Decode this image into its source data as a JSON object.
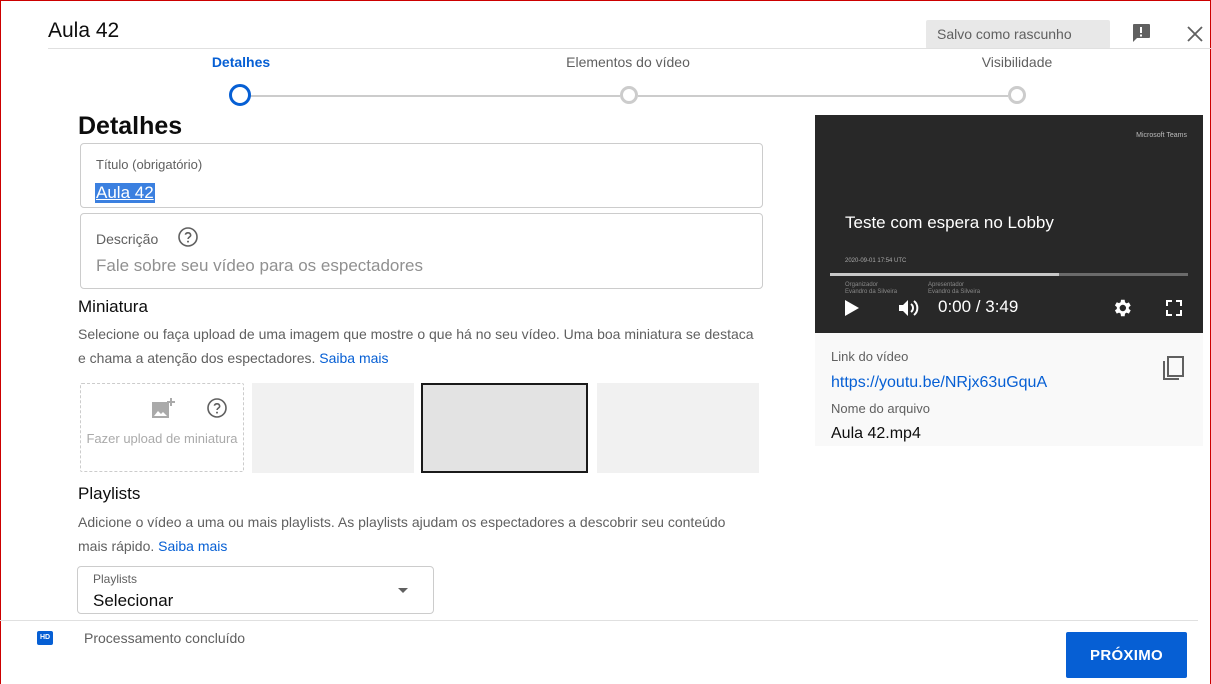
{
  "header": {
    "title": "Aula 42",
    "draft_status": "Salvo como rascunho"
  },
  "stepper": {
    "steps": [
      {
        "label": "Detalhes",
        "state": "active"
      },
      {
        "label": "Elementos do vídeo",
        "state": "inactive"
      },
      {
        "label": "Visibilidade",
        "state": "inactive"
      }
    ]
  },
  "details": {
    "heading": "Detalhes",
    "title_field": {
      "label": "Título (obrigatório)",
      "value": "Aula 42"
    },
    "description_field": {
      "label": "Descrição",
      "placeholder": "Fale sobre seu vídeo para os espectadores"
    }
  },
  "thumbnail": {
    "heading": "Miniatura",
    "description": "Selecione ou faça upload de uma imagem que mostre o que há no seu vídeo. Uma boa miniatura se destaca e chama a atenção dos espectadores.",
    "learn_more": "Saiba mais",
    "upload_label": "Fazer upload de miniatura"
  },
  "playlists": {
    "heading": "Playlists",
    "description": "Adicione o vídeo a uma ou mais playlists. As playlists ajudam os espectadores a descobrir seu conteúdo mais rápido.",
    "learn_more": "Saiba mais",
    "select_label": "Playlists",
    "select_value": "Selecionar"
  },
  "video": {
    "brand": "Microsoft Teams",
    "overlay_title": "Teste com espera no Lobby",
    "overlay_date": "2020-09-01 17:54 UTC",
    "organizer_label": "Organizador",
    "organizer_name": "Evandro da Silveira",
    "presenter_label": "Apresentador",
    "presenter_name": "Evandro da Silveira",
    "time": "0:00 / 3:49",
    "progress": 0.64,
    "link_label": "Link do vídeo",
    "link": "https://youtu.be/NRjx63uGquA",
    "filename_label": "Nome do arquivo",
    "filename": "Aula 42.mp4"
  },
  "footer": {
    "hd_badge": "HD",
    "status": "Processamento concluído",
    "next_label": "PRÓXIMO"
  },
  "colors": {
    "accent": "#065fd4",
    "frame": "#cc0000"
  }
}
